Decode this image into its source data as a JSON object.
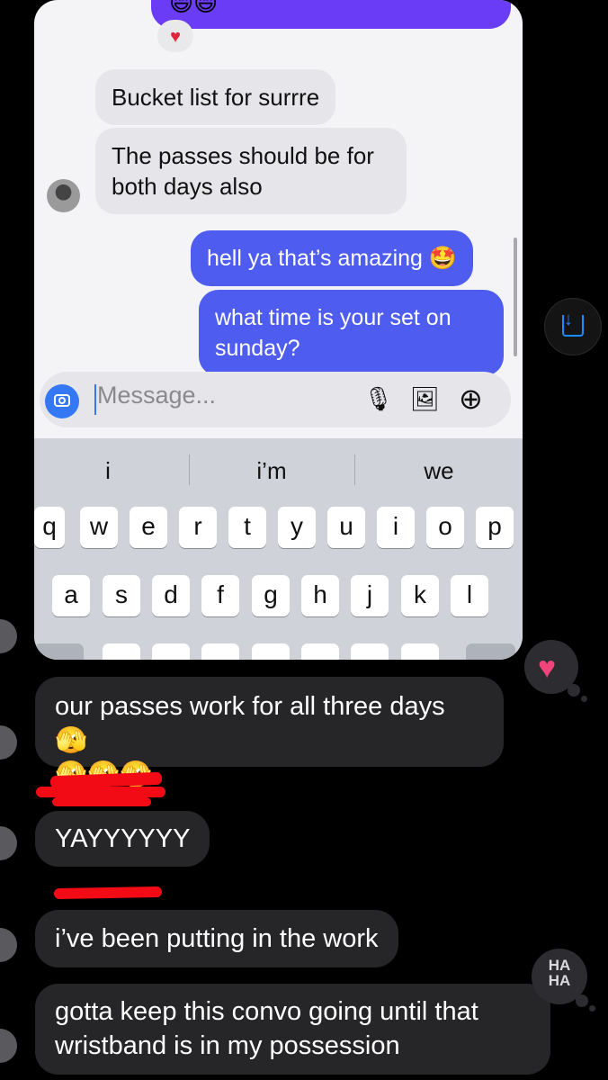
{
  "embedded": {
    "top_emojis": "😄😄",
    "heart_reaction": "♥",
    "incoming": [
      "Bucket list for surrre",
      "The passes should be for both days also"
    ],
    "outgoing": [
      "hell ya that’s amazing 🤩",
      "what time is your set on sunday?"
    ],
    "composer": {
      "placeholder": "Message...",
      "mic_icon": "🎙",
      "gallery_icon": "🖼",
      "plus_icon": "⊕"
    },
    "keyboard": {
      "suggestions": [
        "i",
        "i’m",
        "we"
      ],
      "row1": [
        "q",
        "w",
        "e",
        "r",
        "t",
        "y",
        "u",
        "i",
        "o",
        "p"
      ],
      "row2": [
        "a",
        "s",
        "d",
        "f",
        "g",
        "h",
        "j",
        "k",
        "l"
      ]
    }
  },
  "download_icon": "download-icon",
  "chat": {
    "messages": [
      "our passes work for all three days 🫣",
      "🫣🫣🫣",
      "YAYYYYYY",
      "i’ve been putting in the work",
      "gotta keep this convo going until that",
      "wristband is in my possession"
    ],
    "reaction_heart": "♥",
    "reaction_haha": [
      "HA",
      "HA"
    ]
  },
  "colors": {
    "outgoing_bubble": "#4e5cf0",
    "incoming_bubble_light": "#e6e6ea",
    "incoming_bubble_dark": "#262629",
    "heart": "#f0447a",
    "redaction": "#f20a15"
  }
}
